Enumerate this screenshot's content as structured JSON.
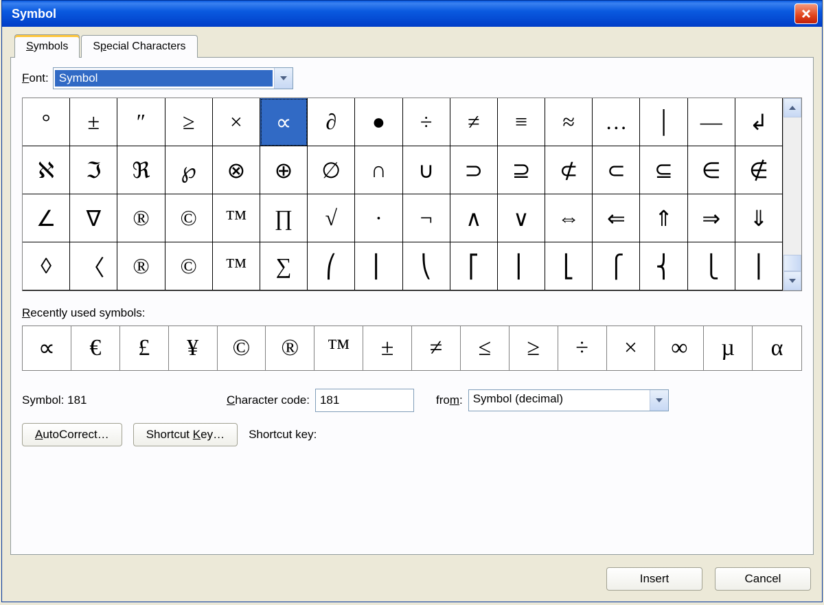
{
  "title": "Symbol",
  "tabs": {
    "symbols": "Symbols",
    "special": "Special Characters"
  },
  "font": {
    "label": "Font:",
    "value": "Symbol"
  },
  "grid": {
    "selectedIndex": 5,
    "symbols": [
      "°",
      "±",
      "″",
      "≥",
      "×",
      "∝",
      "∂",
      "●",
      "÷",
      "≠",
      "≡",
      "≈",
      "…",
      "│",
      "—",
      "↲",
      "ℵ",
      "ℑ",
      "ℜ",
      "℘",
      "⊗",
      "⊕",
      "∅",
      "∩",
      "∪",
      "⊃",
      "⊇",
      "⊄",
      "⊂",
      "⊆",
      "∈",
      "∉",
      "∠",
      "∇",
      "®",
      "©",
      "™",
      "∏",
      "√",
      "·",
      "¬",
      "∧",
      "∨",
      "⇔",
      "⇐",
      "⇑",
      "⇒",
      "⇓",
      "◊",
      "〈",
      "®",
      "©",
      "™",
      "∑",
      "⎛",
      "⎜",
      "⎝",
      "⎡",
      "⎢",
      "⎣",
      "⎧",
      "⎨",
      "⎩",
      "⎪"
    ]
  },
  "recent": {
    "label": "Recently used symbols:",
    "symbols": [
      "∝",
      "€",
      "£",
      "¥",
      "©",
      "®",
      "™",
      "±",
      "≠",
      "≤",
      "≥",
      "÷",
      "×",
      "∞",
      "µ",
      "α"
    ]
  },
  "info": {
    "symbol_label": "Symbol: 181",
    "char_label": "Character code:",
    "char_value": "181",
    "from_label": "from:",
    "from_value": "Symbol (decimal)"
  },
  "buttons": {
    "autocorrect": "AutoCorrect…",
    "shortcutkey": "Shortcut Key…",
    "shortcut_label": "Shortcut key:",
    "insert": "Insert",
    "cancel": "Cancel"
  }
}
